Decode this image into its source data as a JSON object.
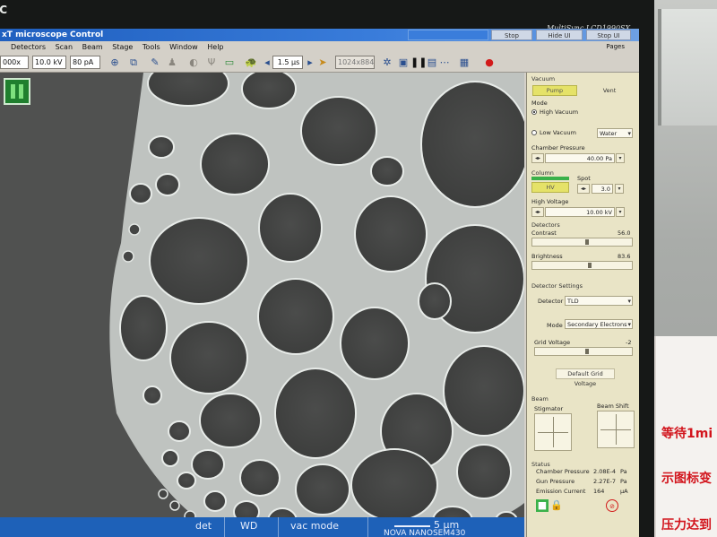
{
  "monitor": {
    "brand_left": "EC",
    "brand_right": "MultiSync LCD1990SX"
  },
  "window": {
    "title": "xT microscope Control",
    "title_buttons": [
      "Stop",
      "Hide UI",
      "Stop UI"
    ]
  },
  "menu": {
    "items": [
      "Detectors",
      "Scan",
      "Beam",
      "Stage",
      "Tools",
      "Window",
      "Help"
    ],
    "pages_label": "Pages"
  },
  "toolbar": {
    "magnification": "000x",
    "voltage": "10.0 kV",
    "current": "80 pA",
    "scan_speed": "1.5 µs",
    "resolution": "1024x884"
  },
  "databar": {
    "scale_text": "5 µm",
    "instrument": "NOVA  NANOSEM430",
    "labels": [
      "det",
      "WD",
      "vac mode"
    ]
  },
  "panel": {
    "vacuum": {
      "title": "Vacuum",
      "pump_label": "Pump",
      "vent_label": "Vent",
      "mode_title": "Mode",
      "high_vacuum": "High Vacuum",
      "low_vacuum": "Low Vacuum",
      "gas": "Water",
      "chamber_pressure_label": "Chamber Pressure",
      "chamber_pressure_value": "40.00 Pa"
    },
    "column": {
      "title": "Column",
      "hv_label": "HV",
      "spot_label": "Spot",
      "spot_value": "3.0",
      "high_voltage_label": "High Voltage",
      "high_voltage_value": "10.00 kV"
    },
    "detectors": {
      "title": "Detectors",
      "contrast_label": "Contrast",
      "contrast_value": "56.0",
      "brightness_label": "Brightness",
      "brightness_value": "83.6"
    },
    "detector_settings": {
      "title": "Detector Settings",
      "detector_label": "Detector",
      "detector_value": "TLD",
      "mode_label": "Mode",
      "mode_value": "Secondary Electrons",
      "grid_voltage_label": "Grid Voltage",
      "grid_voltage_value": "-2",
      "default_button": "Default Grid Voltage"
    },
    "beam": {
      "title": "Beam",
      "stigmator_label": "Stigmator",
      "beam_shift_label": "Beam Shift"
    },
    "status": {
      "title": "Status",
      "rows": [
        {
          "label": "Chamber Pressure",
          "value": "2.08E-4",
          "unit": "Pa"
        },
        {
          "label": "Gun Pressure",
          "value": "2.27E-7",
          "unit": "Pa"
        },
        {
          "label": "Emission Current",
          "value": "164",
          "unit": "µA"
        }
      ]
    }
  },
  "sign_text": [
    "等待1mi",
    "示图标变",
    "压力达到"
  ],
  "colors": {
    "titlebar": "#1f5fbf",
    "databar": "#1e61b8",
    "panel": "#e9e4c6",
    "pump_button": "#e5e268",
    "status_green": "#3ab14a"
  }
}
